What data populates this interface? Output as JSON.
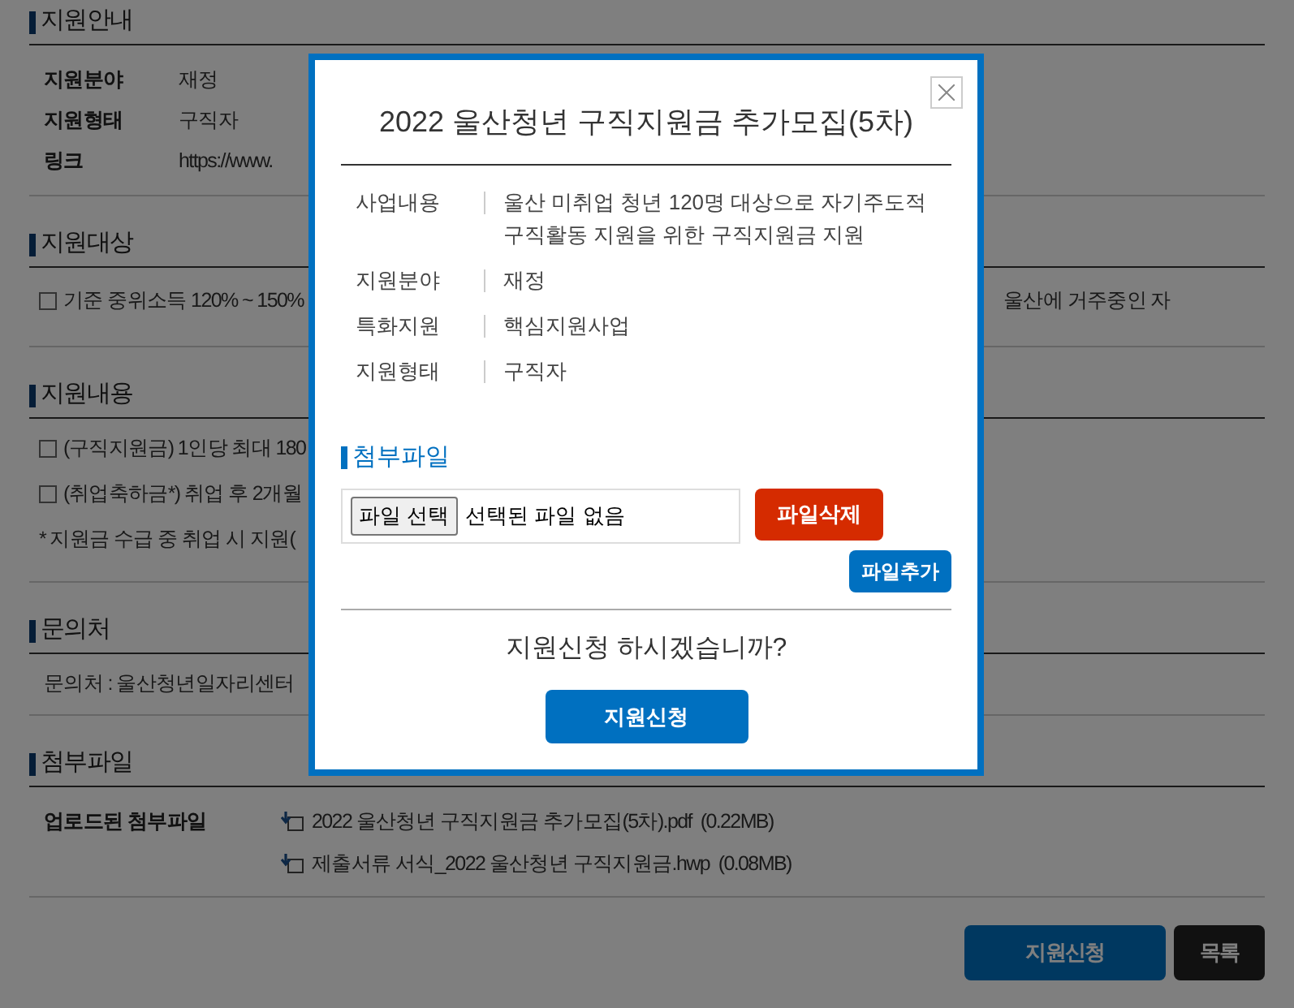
{
  "page": {
    "sections": [
      {
        "title": "지원안내",
        "kind": "fields",
        "rows": [
          {
            "label": "지원분야",
            "value": "재정"
          },
          {
            "label": "지원형태",
            "value": "구직자"
          },
          {
            "label": "링크",
            "value": "https://www."
          }
        ]
      },
      {
        "title": "지원대상",
        "kind": "bullets",
        "items": [
          {
            "text": "기준 중위소득 120% ~ 150%",
            "tail": "울산에 거주중인 자"
          }
        ]
      },
      {
        "title": "지원내용",
        "kind": "bullets",
        "items": [
          {
            "text": "(구직지원금) 1인당 최대 180"
          },
          {
            "text": "(취업축하금*) 취업 후 2개월"
          }
        ],
        "note": "* 지원금 수급 중 취업 시 지원("
      },
      {
        "title": "문의처",
        "kind": "text",
        "text": "문의처 : 울산청년일자리센터"
      },
      {
        "title": "첨부파일",
        "kind": "files",
        "label": "업로드된 첨부파일",
        "files": [
          {
            "name": "2022 울산청년 구직지원금 추가모집(5차).pdf",
            "size": "(0.22MB)"
          },
          {
            "name": "제출서류 서식_2022 울산청년 구직지원금.hwp",
            "size": "(0.08MB)"
          }
        ]
      }
    ],
    "buttons": [
      {
        "label": "지원신청",
        "kind": "primary"
      },
      {
        "label": "목록",
        "kind": "dark"
      }
    ]
  },
  "modal": {
    "title": "2022 울산청년 구직지원금 추가모집(5차)",
    "rows": [
      {
        "label": "사업내용",
        "value": "울산 미취업 청년 120명 대상으로 자기주도적\n구직활동 지원을 위한 구직지원금 지원"
      },
      {
        "label": "지원분야",
        "value": "재정"
      },
      {
        "label": "특화지원",
        "value": "핵심지원사업"
      },
      {
        "label": "지원형태",
        "value": "구직자"
      }
    ],
    "attachment_heading": "첨부파일",
    "file_input": {
      "button": "파일 선택",
      "status": "선택된 파일 없음"
    },
    "delete_button": "파일삭제",
    "add_button": "파일추가",
    "question": "지원신청 하시겠습니까?",
    "submit_button": "지원신청"
  }
}
